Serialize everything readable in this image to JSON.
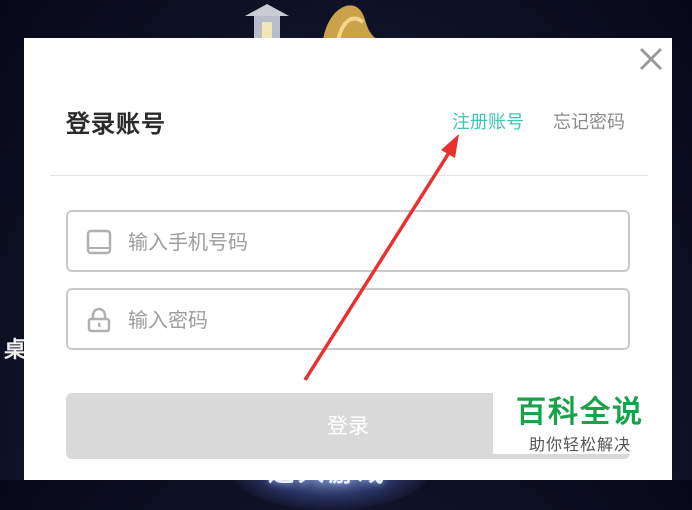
{
  "dialog": {
    "title": "登录账号",
    "register_link": "注册账号",
    "forgot_link": "忘记密码",
    "phone_placeholder": "输入手机号码",
    "password_placeholder": "输入密码",
    "login_button": "登录"
  },
  "background": {
    "side_glyph": "桌",
    "enter_text": "进入游戏"
  },
  "watermark": {
    "main": "百科全说",
    "sub": "助你轻松解决"
  },
  "colors": {
    "accent": "#3fc5b5",
    "link_muted": "#8a8a8a",
    "button_disabled": "#d9d9d9",
    "annotation": "#e8312f",
    "watermark_green": "#1aa24b"
  },
  "icons": [
    "close-icon",
    "phone-icon",
    "lock-icon",
    "annotation-arrow"
  ]
}
